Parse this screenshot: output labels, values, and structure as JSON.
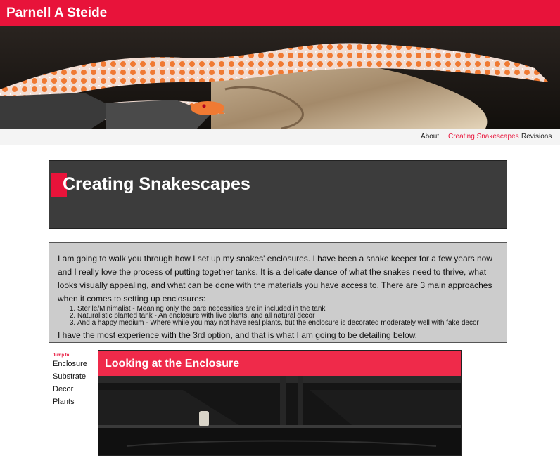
{
  "site": {
    "title": "Parnell A Steide"
  },
  "nav": {
    "items": [
      "About",
      "Creating Snakescapes",
      "Revisions"
    ],
    "active": "Creating Snakescapes"
  },
  "page": {
    "title": "Creating Snakescapes"
  },
  "intro": {
    "paragraph": "I am going to walk you through how I set up my snakes' enclosures. I have been a snake keeper for a few years now and I really love the process of putting together tanks. It is a delicate dance of what the snakes need to thrive, what looks visually appealing, and what can be done with the materials you have access to. There are 3 main approaches when it comes to setting up enclosures:",
    "list": [
      "Sterile/Minimalist - Meaning only the bare necessities are in included in the tank",
      "Naturalistic planted tank - An enclosure with live plants, and all natural decor",
      "And a happy medium - Where while you may not have real plants, but the enclosure is decorated moderately well with fake decor"
    ],
    "closing": "I have the most experience with the 3rd option, and that is what I am going to be detailing below."
  },
  "jump": {
    "label": "Jump to:",
    "links": [
      "Enclosure",
      "Substrate",
      "Decor",
      "Plants"
    ]
  },
  "section": {
    "title": "Looking at the Enclosure"
  },
  "colors": {
    "accent": "#e8133a",
    "panel_dark": "#3c3c3c",
    "panel_light": "#cccccc",
    "nav_bg": "#f4f4f4"
  }
}
